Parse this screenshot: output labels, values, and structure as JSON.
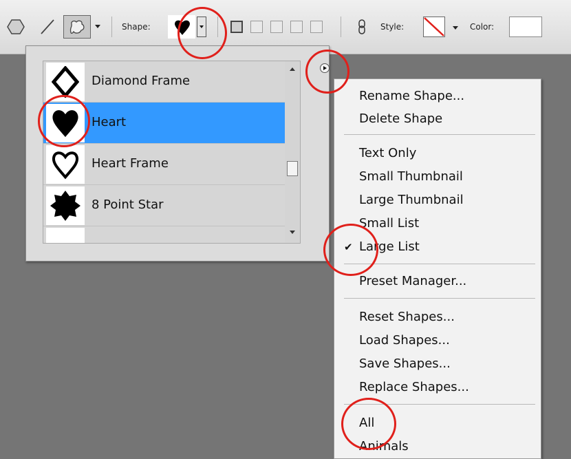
{
  "options_bar": {
    "shape_label": "Shape:",
    "style_label": "Style:",
    "color_label": "Color:",
    "tool_icons": [
      "polygon-icon",
      "line-icon",
      "custom-shape-icon"
    ],
    "swatch_color": "#ffffff",
    "style_swatch": "none-red-slash"
  },
  "shape_picker": {
    "items": [
      {
        "name": "Diamond Frame",
        "icon": "diamond-frame-icon",
        "selected": false
      },
      {
        "name": "Heart",
        "icon": "heart-icon",
        "selected": true
      },
      {
        "name": "Heart Frame",
        "icon": "heart-frame-icon",
        "selected": false
      },
      {
        "name": "8 Point Star",
        "icon": "star-8-icon",
        "selected": false
      }
    ]
  },
  "flyout_menu": {
    "group1": [
      "Rename Shape...",
      "Delete Shape"
    ],
    "group2": [
      "Text Only",
      "Small Thumbnail",
      "Large Thumbnail",
      "Small List",
      "Large List"
    ],
    "checked": "Large List",
    "group3": [
      "Preset Manager..."
    ],
    "group4": [
      "Reset Shapes...",
      "Load Shapes...",
      "Save Shapes...",
      "Replace Shapes..."
    ],
    "group5": [
      "All",
      "Animals"
    ]
  },
  "colors": {
    "selection": "#3399ff",
    "annotation": "#e0201b",
    "canvas": "#757575"
  }
}
